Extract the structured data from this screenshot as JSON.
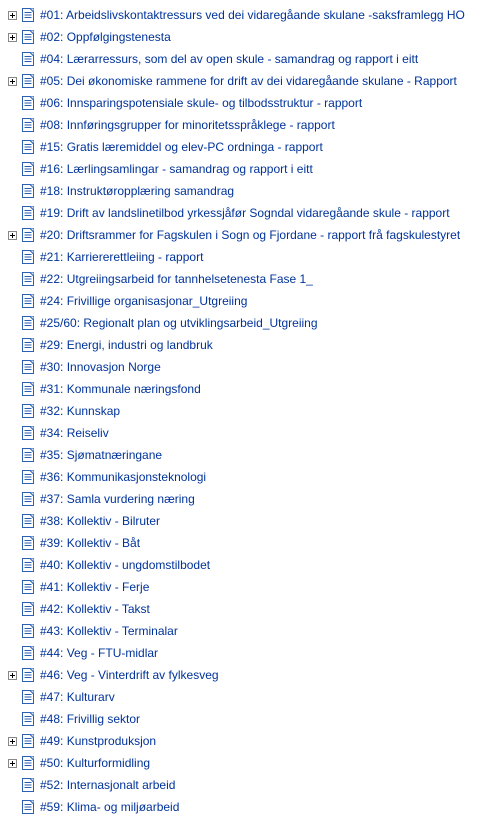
{
  "items": [
    {
      "expandable": true,
      "label": "#01: Arbeidslivskontaktressurs ved dei vidaregåande skulane -saksframlegg HO"
    },
    {
      "expandable": true,
      "label": "#02: Oppfølgingstenesta"
    },
    {
      "expandable": false,
      "label": "#04: Lærarressurs, som del av open skule - samandrag og rapport i eitt"
    },
    {
      "expandable": true,
      "label": "#05: Dei økonomiske rammene for drift av dei vidaregåande skulane - Rapport"
    },
    {
      "expandable": false,
      "label": "#06: Innsparingspotensiale skule- og tilbodsstruktur - rapport"
    },
    {
      "expandable": false,
      "label": "#08: Innføringsgrupper for minoritetsspråklege - rapport"
    },
    {
      "expandable": false,
      "label": "#15: Gratis læremiddel  og elev-PC ordninga - rapport"
    },
    {
      "expandable": false,
      "label": "#16: Lærlingsamlingar - samandrag og rapport i eitt"
    },
    {
      "expandable": false,
      "label": "#18: Instruktøropplæring samandrag"
    },
    {
      "expandable": false,
      "label": "#19: Drift av landslinetilbod yrkessjåfør Sogndal vidaregåande skule - rapport"
    },
    {
      "expandable": true,
      "label": "#20: Driftsrammer for Fagskulen i Sogn og Fjordane - rapport frå fagskulestyret"
    },
    {
      "expandable": false,
      "label": "#21: Karriererettleiing - rapport"
    },
    {
      "expandable": false,
      "label": "#22:  Utgreiingsarbeid for tannhelsetenesta Fase 1_"
    },
    {
      "expandable": false,
      "label": "#24: Frivillige organisasjonar_Utgreiing"
    },
    {
      "expandable": false,
      "label": "#25/60: Regionalt plan og utviklingsarbeid_Utgreiing"
    },
    {
      "expandable": false,
      "label": "#29: Energi, industri og landbruk"
    },
    {
      "expandable": false,
      "label": "#30:  Innovasjon Norge"
    },
    {
      "expandable": false,
      "label": "#31: Kommunale næringsfond"
    },
    {
      "expandable": false,
      "label": "#32: Kunnskap"
    },
    {
      "expandable": false,
      "label": "#34:  Reiseliv"
    },
    {
      "expandable": false,
      "label": "#35:  Sjømatnæringane"
    },
    {
      "expandable": false,
      "label": "#36: Kommunikasjonsteknologi"
    },
    {
      "expandable": false,
      "label": "#37: Samla vurdering næring"
    },
    {
      "expandable": false,
      "label": "#38: Kollektiv - Bilruter"
    },
    {
      "expandable": false,
      "label": "#39: Kollektiv - Båt"
    },
    {
      "expandable": false,
      "label": "#40: Kollektiv - ungdomstilbodet"
    },
    {
      "expandable": false,
      "label": "#41: Kollektiv - Ferje"
    },
    {
      "expandable": false,
      "label": "#42: Kollektiv - Takst"
    },
    {
      "expandable": false,
      "label": "#43: Kollektiv - Terminalar"
    },
    {
      "expandable": false,
      "label": "#44: Veg - FTU-midlar"
    },
    {
      "expandable": true,
      "label": "#46: Veg - Vinterdrift av fylkesveg"
    },
    {
      "expandable": false,
      "label": "#47: Kulturarv"
    },
    {
      "expandable": false,
      "label": "#48: Frivillig sektor"
    },
    {
      "expandable": true,
      "label": "#49: Kunstproduksjon"
    },
    {
      "expandable": true,
      "label": "#50: Kulturformidling"
    },
    {
      "expandable": false,
      "label": "#52: Internasjonalt arbeid"
    },
    {
      "expandable": false,
      "label": "#59: Klima- og miljøarbeid"
    }
  ]
}
